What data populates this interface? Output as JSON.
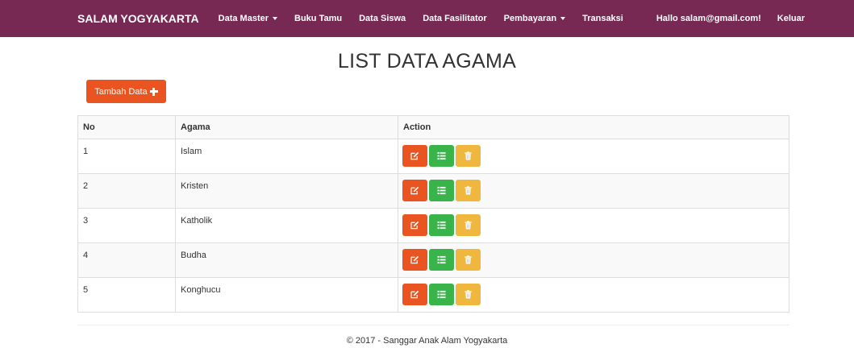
{
  "navbar": {
    "brand": "SALAM YOGYAKARTA",
    "items": [
      {
        "label": "Data Master",
        "dropdown": true
      },
      {
        "label": "Buku Tamu",
        "dropdown": false
      },
      {
        "label": "Data Siswa",
        "dropdown": false
      },
      {
        "label": "Data Fasilitator",
        "dropdown": false
      },
      {
        "label": "Pembayaran",
        "dropdown": true
      },
      {
        "label": "Transaksi",
        "dropdown": false
      }
    ],
    "greeting": "Hallo salam@gmail.com!",
    "logout_label": "Keluar",
    "background_color": "#772953"
  },
  "page": {
    "title": "LIST DATA AGAMA",
    "add_button_label": "Tambah Data"
  },
  "table": {
    "headers": [
      "No",
      "Agama",
      "Action"
    ],
    "rows": [
      {
        "no": "1",
        "agama": "Islam"
      },
      {
        "no": "2",
        "agama": "Kristen"
      },
      {
        "no": "3",
        "agama": "Katholik"
      },
      {
        "no": "4",
        "agama": "Budha"
      },
      {
        "no": "5",
        "agama": "Konghucu"
      }
    ],
    "action_icons": [
      "edit-icon",
      "list-icon",
      "trash-icon"
    ],
    "action_colors": {
      "edit": "#e95420",
      "detail": "#38b44a",
      "delete": "#efb73e"
    }
  },
  "footer": {
    "text": "© 2017 - Sanggar Anak Alam Yogyakarta"
  }
}
